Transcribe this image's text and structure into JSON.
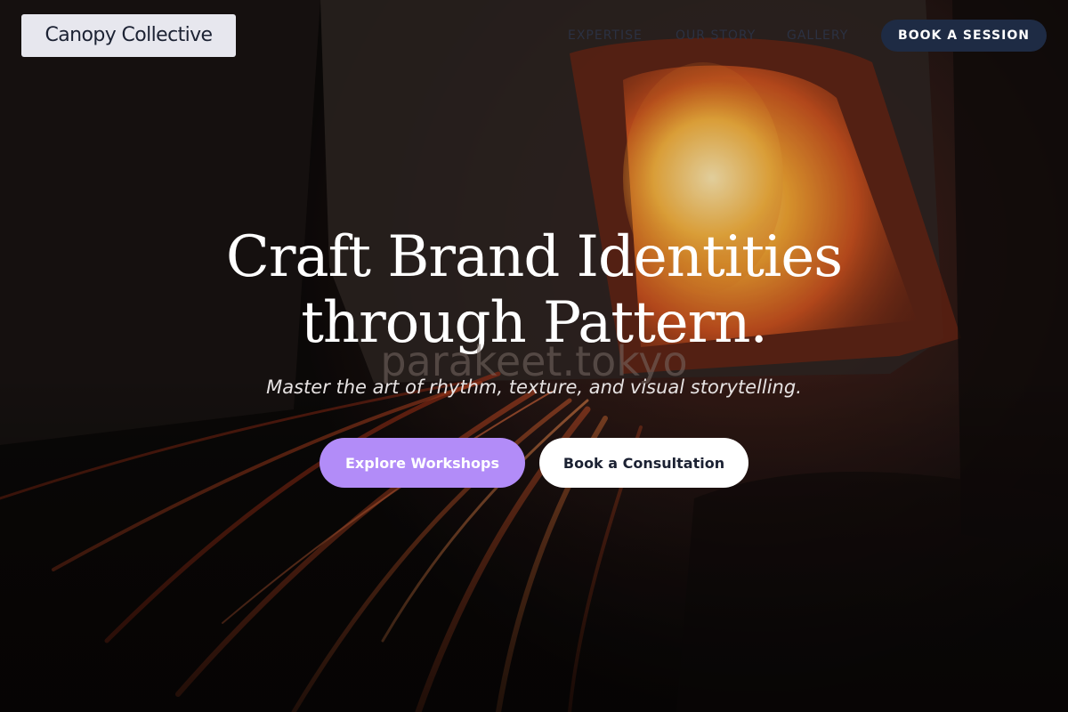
{
  "brand": {
    "logo_text": "Canopy Collective"
  },
  "nav": {
    "links": [
      {
        "label": "EXPERTISE"
      },
      {
        "label": "OUR STORY"
      },
      {
        "label": "GALLERY"
      }
    ],
    "cta_label": "BOOK A SESSION"
  },
  "hero": {
    "headline_line1": "Craft Brand Identities",
    "headline_line2": "through Pattern.",
    "watermark": "parakeet.tokyo",
    "subtitle": "Master the art of rhythm, texture, and visual storytelling.",
    "primary_cta": "Explore Workshops",
    "secondary_cta": "Book a Consultation"
  },
  "colors": {
    "accent": "#b28cf8",
    "nav_button": "#1e2b44",
    "logo_bg": "#e7e7ee",
    "text_dark": "#1c2233"
  }
}
